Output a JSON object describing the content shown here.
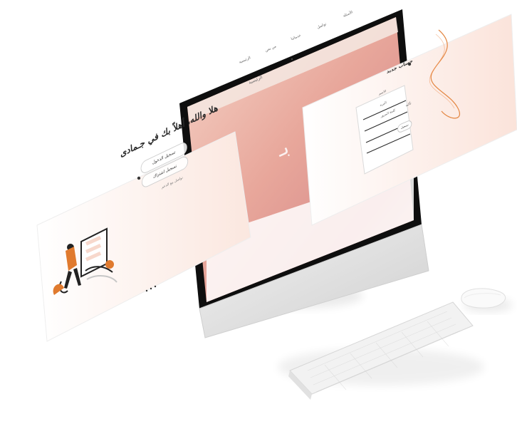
{
  "scene": {
    "hero_text": "هلا والله، أهلاً بك في جـمادى",
    "left_buttons": [
      "تسجيل الدخول",
      "تسجيل اشتراك"
    ],
    "left_helper": "تواصل مع الدعم",
    "top_nav": [
      "الرئيسية",
      "من نحن",
      "خدماتنا",
      "تواصل",
      "الأسئلة"
    ],
    "form": {
      "title": "حساب جديد",
      "fields": [
        "الاسم",
        "البريد",
        "كلمة المرور",
        "تأكيد"
      ],
      "submit": "تسجيل"
    }
  },
  "colors": {
    "accent": "#E07A2E",
    "peach": "#F5D2C6",
    "panel_border": "#E9E9E9",
    "device_silver": "#D9D9D9",
    "dark": "#1A1A1A"
  }
}
